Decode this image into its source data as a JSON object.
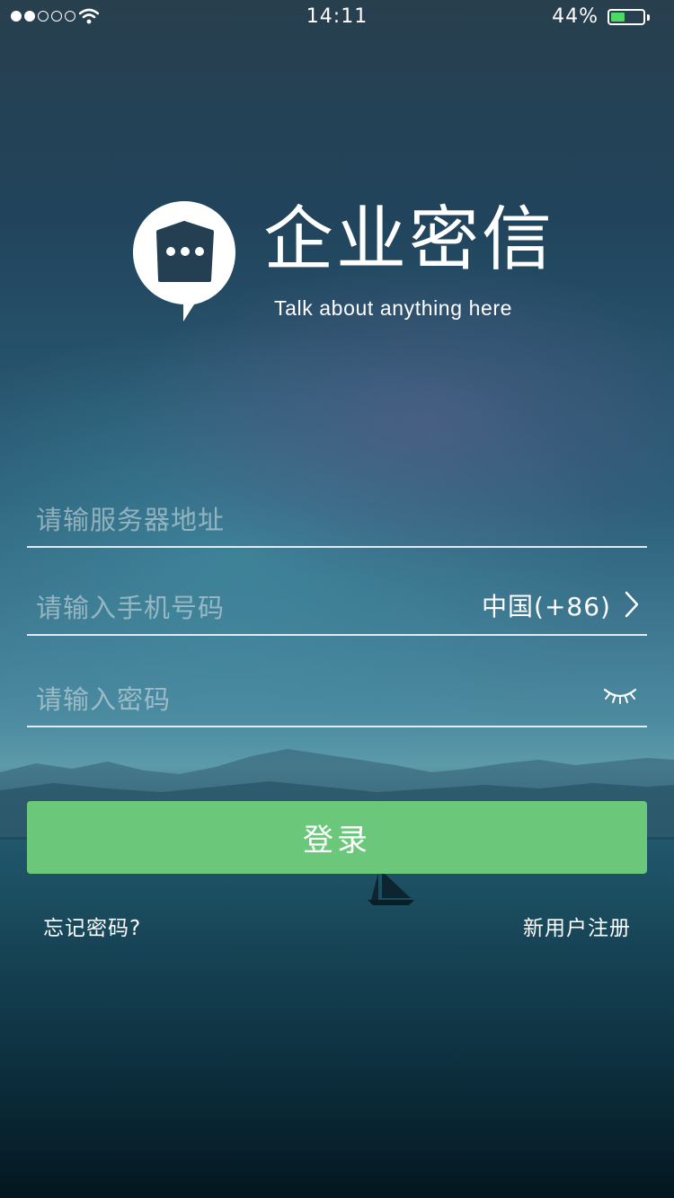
{
  "status_bar": {
    "signal_bars": 2,
    "signal_total": 5,
    "time": "14:11",
    "battery_percent_text": "44%",
    "battery_level": 0.44,
    "battery_color": "#4cd964"
  },
  "brand": {
    "app_name": "企业密信",
    "tagline": "Talk about anything here"
  },
  "form": {
    "server_placeholder": "请输服务器地址",
    "phone_placeholder": "请输入手机号码",
    "country_code": "中国(+86)",
    "password_placeholder": "请输入密码",
    "login_label": "登录",
    "login_color": "#6bc87a"
  },
  "links": {
    "forgot_password": "忘记密码?",
    "register": "新用户注册"
  }
}
